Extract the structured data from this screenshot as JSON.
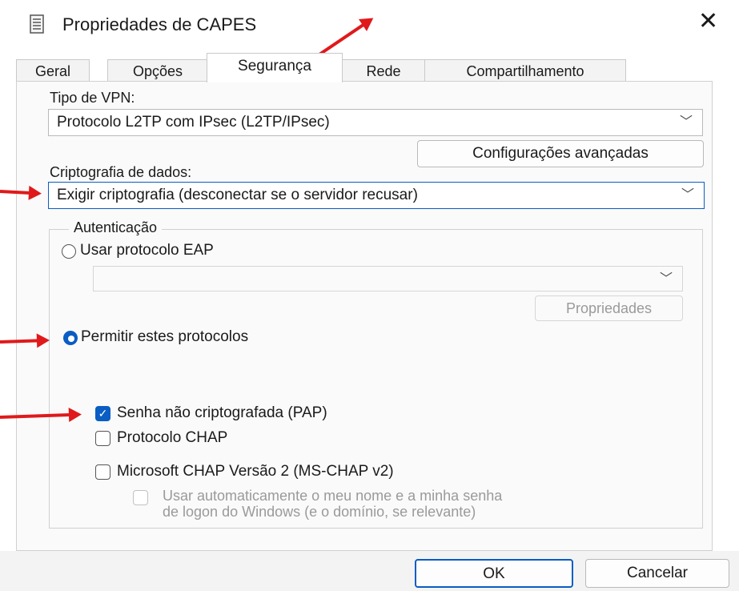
{
  "window": {
    "title": "Propriedades de CAPES",
    "icon": "document-icon",
    "close_label": "✕"
  },
  "tabs": [
    {
      "label": "Geral"
    },
    {
      "label": "Opções"
    },
    {
      "label": "Segurança"
    },
    {
      "label": "Rede"
    },
    {
      "label": "Compartilhamento"
    }
  ],
  "vpn": {
    "label": "Tipo de VPN:",
    "value": "Protocolo L2TP com IPsec (L2TP/IPsec)",
    "advanced_button": "Configurações avançadas"
  },
  "encryption": {
    "label": "Criptografia de dados:",
    "value": "Exigir criptografia (desconectar se o servidor recusar)"
  },
  "auth": {
    "legend": "Autenticação",
    "eap_label": "Usar protocolo EAP",
    "eap_select_value": "",
    "eap_properties_button": "Propriedades",
    "allow_label": "Permitir estes protocolos",
    "pap_label": "Senha não criptografada (PAP)",
    "pap_checked": true,
    "chap_label": "Protocolo CHAP",
    "chap_checked": false,
    "mschap_label": "Microsoft CHAP Versão 2 (MS-CHAP v2)",
    "mschap_checked": false,
    "auto_logon_line1": "Usar automaticamente o meu nome e a minha senha",
    "auto_logon_line2": "de logon do Windows (e o domínio, se relevante)",
    "selected_option": "allow"
  },
  "footer": {
    "ok": "OK",
    "cancel": "Cancelar"
  },
  "colors": {
    "accent": "#0a5dc2",
    "annotation_arrow": "#e0191b"
  }
}
